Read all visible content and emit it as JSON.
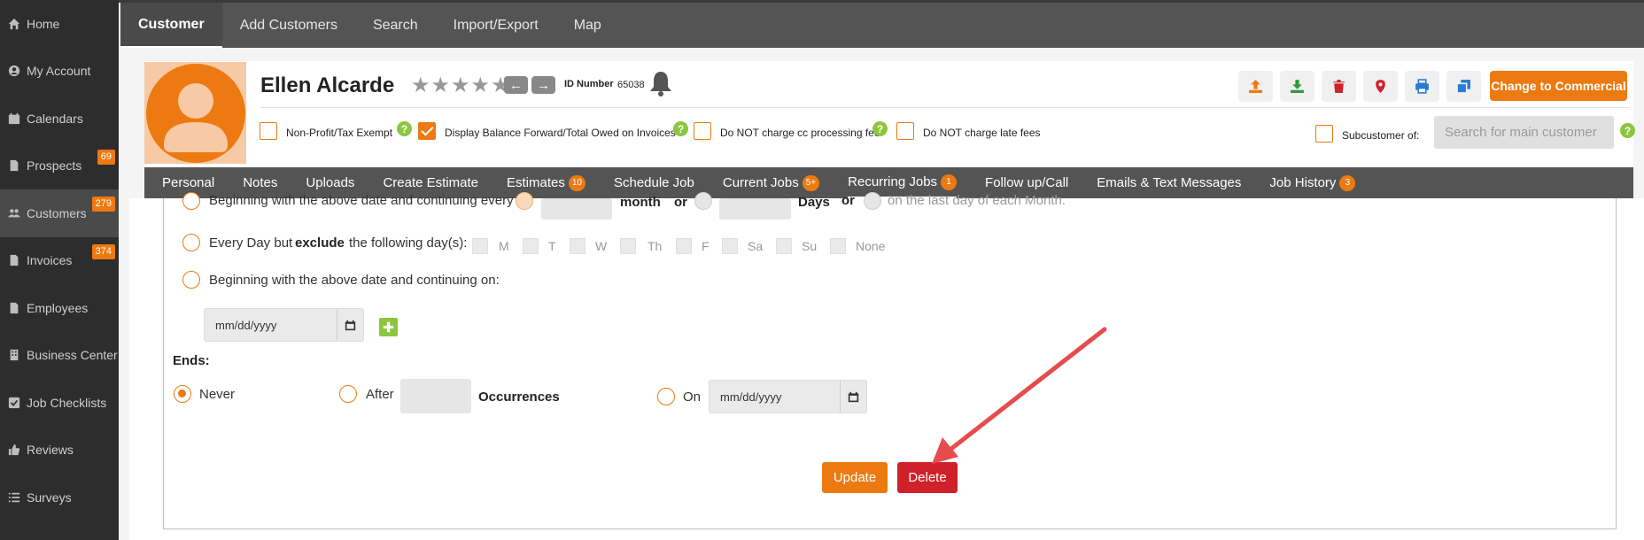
{
  "sidebar": {
    "items": [
      {
        "label": "Home",
        "icon": "home-icon"
      },
      {
        "label": "My Account",
        "icon": "user-circle-icon"
      },
      {
        "label": "Calendars",
        "icon": "calendar-icon"
      },
      {
        "label": "Prospects",
        "icon": "file-icon",
        "badge": "69"
      },
      {
        "label": "Customers",
        "icon": "users-icon",
        "badge": "279"
      },
      {
        "label": "Invoices",
        "icon": "file-icon",
        "badge": "374"
      },
      {
        "label": "Employees",
        "icon": "file-icon"
      },
      {
        "label": "Business Center",
        "icon": "building-icon"
      },
      {
        "label": "Job Checklists",
        "icon": "checkbox-icon"
      },
      {
        "label": "Reviews",
        "icon": "thumbs-up-icon"
      },
      {
        "label": "Surveys",
        "icon": "list-icon"
      }
    ]
  },
  "topnav": {
    "items": [
      "Customer",
      "Add Customers",
      "Search",
      "Import/Export",
      "Map"
    ]
  },
  "customer": {
    "name": "Ellen Alcarde",
    "id_label": "ID Number",
    "id_value": "65038",
    "commercial_button": "Change to Commercial",
    "rating": 0
  },
  "options": {
    "nonprofit": "Non-Profit/Tax Exempt",
    "balance": "Display Balance Forward/Total Owed on Invoices",
    "nocc": "Do NOT charge cc processing fee",
    "nolate": "Do NOT charge late fees",
    "subcustomer": "Subcustomer of:",
    "subcustomer_placeholder": "Search for main customer"
  },
  "tabs": [
    {
      "label": "Personal"
    },
    {
      "label": "Notes"
    },
    {
      "label": "Uploads"
    },
    {
      "label": "Create Estimate"
    },
    {
      "label": "Estimates",
      "badge": "10"
    },
    {
      "label": "Schedule Job"
    },
    {
      "label": "Current Jobs",
      "badge": "5+"
    },
    {
      "label": "Recurring Jobs",
      "badge": "1"
    },
    {
      "label": "Follow up/Call"
    },
    {
      "label": "Emails & Text Messages"
    },
    {
      "label": "Job History",
      "badge": "3"
    }
  ],
  "recurring": {
    "row1_text": "Beginning with the above date and continuing every",
    "row1_month": "month",
    "row1_or1": "or",
    "row1_days": "Days",
    "row1_or2": "or",
    "row1_last": "on the last day of each Month.",
    "row2_text": "Every Day but",
    "row2_exclude": "exclude",
    "row2_rest": "the following day(s):",
    "days": [
      "M",
      "T",
      "W",
      "Th",
      "F",
      "Sa",
      "Su",
      "None"
    ],
    "row3_text": "Beginning with the above date and continuing on:",
    "date_placeholder": "mm/dd/yyyy",
    "ends_label": "Ends:",
    "never": "Never",
    "after": "After",
    "occurrences": "Occurrences",
    "on": "On",
    "on_date_placeholder": "mm/dd/yyyy",
    "update": "Update",
    "delete": "Delete"
  },
  "colors": {
    "accent": "#ec7a11",
    "danger": "#d0202a",
    "help": "#8cc63f",
    "arrow": "#e74c4c"
  }
}
